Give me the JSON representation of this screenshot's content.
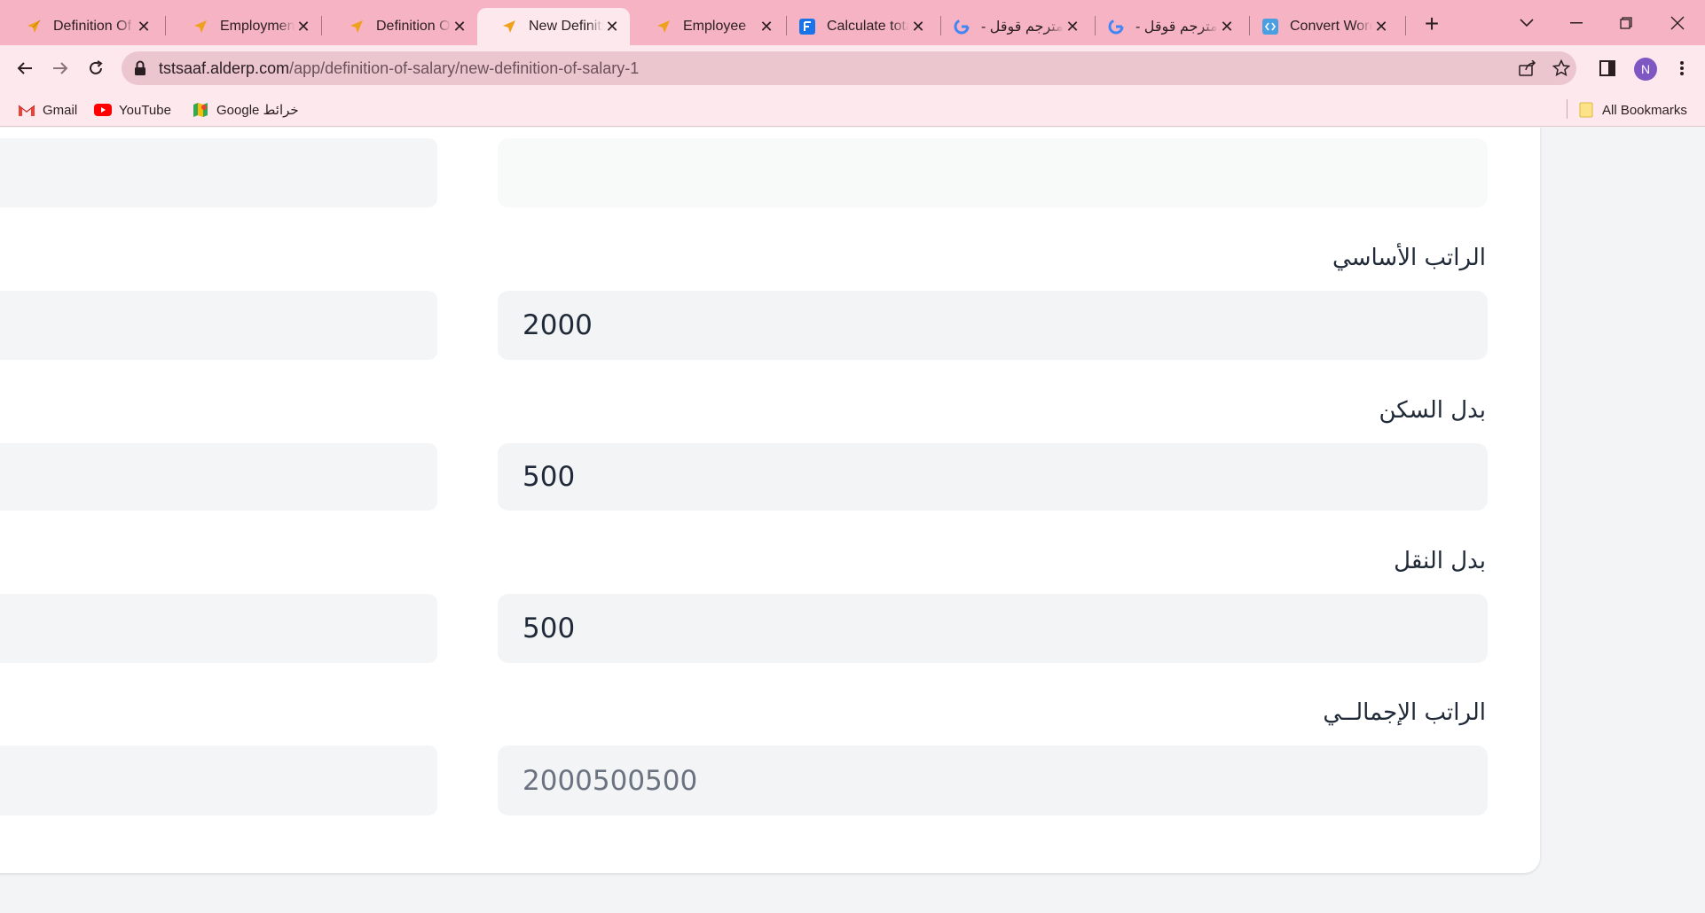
{
  "tabs": [
    {
      "title": "Definition Of",
      "icon": "alderp-logo-icon"
    },
    {
      "title": "Employment",
      "icon": "alderp-logo-icon"
    },
    {
      "title": "Definition Of",
      "icon": "alderp-logo-icon"
    },
    {
      "title": "New Definitio",
      "icon": "alderp-logo-icon",
      "active": true
    },
    {
      "title": "Employee",
      "icon": "alderp-logo-icon"
    },
    {
      "title": "Calculate tota",
      "icon": "forms-f-icon"
    },
    {
      "title": "مترجم قوقل -",
      "icon": "google-g-icon"
    },
    {
      "title": "مترجم قوقل -",
      "icon": "google-g-icon"
    },
    {
      "title": "Convert Word",
      "icon": "code-icon"
    }
  ],
  "address_bar": {
    "domain": "tstsaaf.alderp.com",
    "path": "/app/definition-of-salary/new-definition-of-salary-1"
  },
  "profile": {
    "initial": "N",
    "color": "#7e57c2"
  },
  "bookmarks": [
    {
      "label": "Gmail",
      "icon": "gmail-icon"
    },
    {
      "label": "YouTube",
      "icon": "youtube-icon"
    },
    {
      "label": "Google خرائط",
      "icon": "google-maps-icon"
    }
  ],
  "all_bookmarks_label": "All Bookmarks",
  "form": {
    "basic_salary": {
      "label": "الراتب الأساسي",
      "value": "2000"
    },
    "housing_allowance": {
      "label": "بدل السكن",
      "value": "500"
    },
    "transport_allowance": {
      "label": "بدل النقل",
      "value": "500"
    },
    "total_salary": {
      "label": "الراتب الإجمالــي",
      "value": "2000500500"
    }
  },
  "colors": {
    "tabstrip": "#f6b3c3",
    "toolbar": "#fde8ee",
    "omnibox": "#ecc6cf",
    "field_bg": "#f3f4f6",
    "page_bg": "#f3f4f6"
  }
}
